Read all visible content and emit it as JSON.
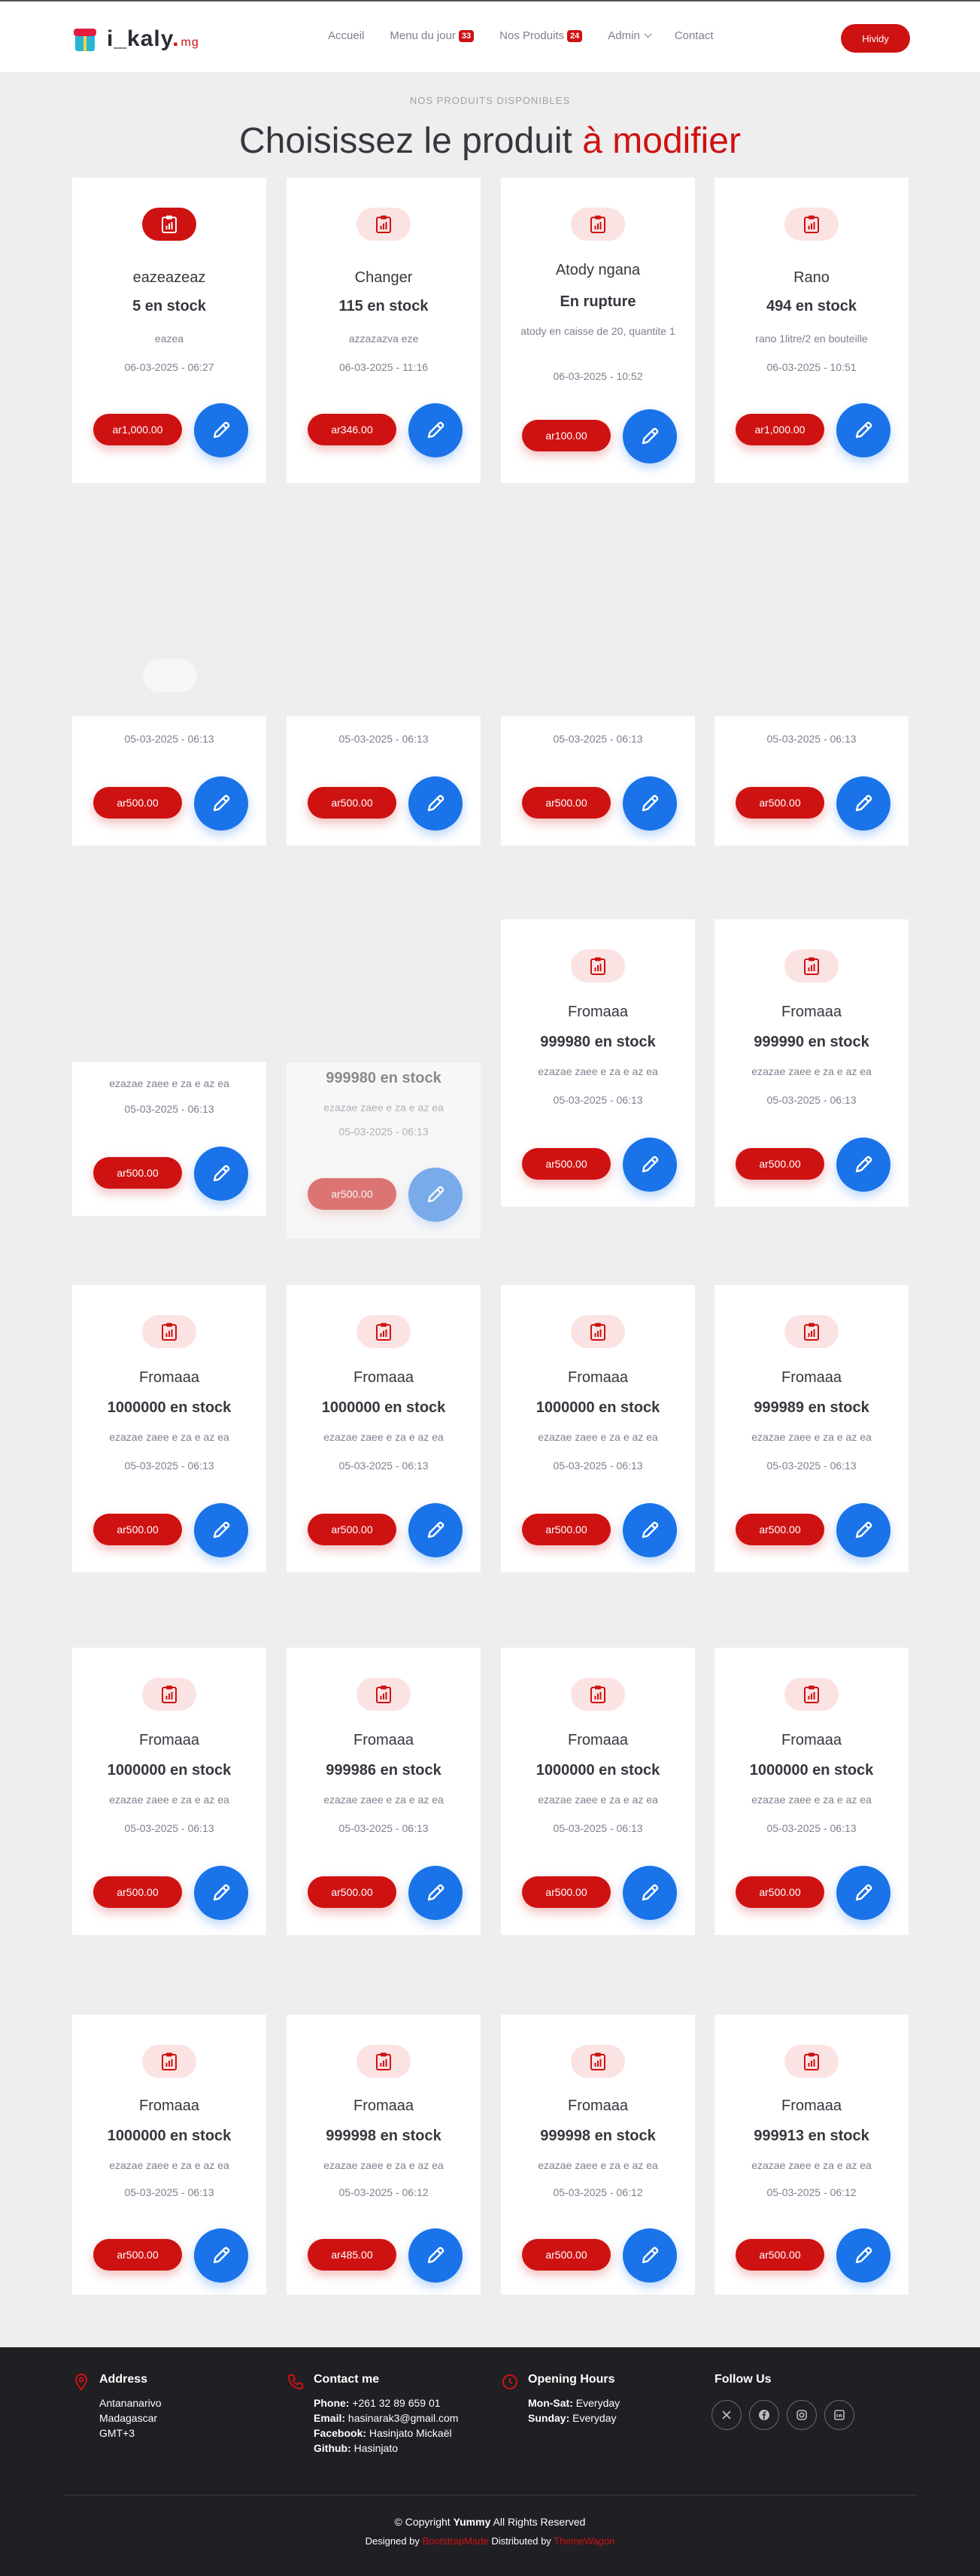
{
  "header": {
    "logo_text": "i_kaly",
    "logo_dot": ".",
    "logo_suffix": "mg",
    "nav": [
      {
        "label": "Accueil"
      },
      {
        "label": "Menu du jour",
        "badge": "33"
      },
      {
        "label": "Nos Produits",
        "badge": "24"
      },
      {
        "label": "Admin"
      },
      {
        "label": "Contact"
      }
    ],
    "cta_label": "Hividy"
  },
  "section": {
    "subtitle": "NOS PRODUITS DISPONIBLES",
    "title_main": "Choisissez le produit",
    "title_accent": "à modifier"
  },
  "products": [
    {
      "name": "eazeazeaz",
      "stock": "5 en stock",
      "desc": "eazea",
      "date": "06-03-2025 - 06:27",
      "price": "ar1,000.00",
      "active": true
    },
    {
      "name": "Changer",
      "stock": "115 en stock",
      "desc": "azzazazva eze",
      "date": "06-03-2025 - 11:16",
      "price": "ar346.00"
    },
    {
      "name": "Atody ngana",
      "stock": "En rupture",
      "desc": "atody en caisse de 20, quantite 1",
      "date": "06-03-2025 - 10:52",
      "price": "ar100.00"
    },
    {
      "name": "Rano",
      "stock": "494 en stock",
      "desc": "rano 1litre/2 en bouteille",
      "date": "06-03-2025 - 10:51",
      "price": "ar1,000.00"
    },
    {
      "date": "05-03-2025 - 06:13",
      "price": "ar500.00"
    },
    {
      "date": "05-03-2025 - 06:13",
      "price": "ar500.00"
    },
    {
      "date": "05-03-2025 - 06:13",
      "price": "ar500.00"
    },
    {
      "date": "05-03-2025 - 06:13",
      "price": "ar500.00"
    },
    {
      "desc": "ezazae zaee e za e az ea",
      "date": "05-03-2025 - 06:13",
      "price": "ar500.00"
    },
    {
      "stock": "999980 en stock",
      "desc": "ezazae zaee e za e az ea",
      "date": "05-03-2025 - 06:13",
      "price": "ar500.00"
    },
    {
      "name": "Fromaaa",
      "stock": "999980 en stock",
      "desc": "ezazae zaee e za e az ea",
      "date": "05-03-2025 - 06:13",
      "price": "ar500.00"
    },
    {
      "name": "Fromaaa",
      "stock": "999990 en stock",
      "desc": "ezazae zaee e za e az ea",
      "date": "05-03-2025 - 06:13",
      "price": "ar500.00"
    },
    {
      "name": "Fromaaa",
      "stock": "1000000 en stock",
      "desc": "ezazae zaee e za e az ea",
      "date": "05-03-2025 - 06:13",
      "price": "ar500.00"
    },
    {
      "name": "Fromaaa",
      "stock": "1000000 en stock",
      "desc": "ezazae zaee e za e az ea",
      "date": "05-03-2025 - 06:13",
      "price": "ar500.00"
    },
    {
      "name": "Fromaaa",
      "stock": "1000000 en stock",
      "desc": "ezazae zaee e za e az ea",
      "date": "05-03-2025 - 06:13",
      "price": "ar500.00"
    },
    {
      "name": "Fromaaa",
      "stock": "999989 en stock",
      "desc": "ezazae zaee e za e az ea",
      "date": "05-03-2025 - 06:13",
      "price": "ar500.00"
    },
    {
      "name": "Fromaaa",
      "stock": "1000000 en stock",
      "desc": "ezazae zaee e za e az ea",
      "date": "05-03-2025 - 06:13",
      "price": "ar500.00"
    },
    {
      "name": "Fromaaa",
      "stock": "999986 en stock",
      "desc": "ezazae zaee e za e az ea",
      "date": "05-03-2025 - 06:13",
      "price": "ar500.00"
    },
    {
      "name": "Fromaaa",
      "stock": "1000000 en stock",
      "desc": "ezazae zaee e za e az ea",
      "date": "05-03-2025 - 06:13",
      "price": "ar500.00"
    },
    {
      "name": "Fromaaa",
      "stock": "1000000 en stock",
      "desc": "ezazae zaee e za e az ea",
      "date": "05-03-2025 - 06:13",
      "price": "ar500.00"
    },
    {
      "name": "Fromaaa",
      "stock": "1000000 en stock",
      "desc": "ezazae zaee e za e az ea",
      "date": "05-03-2025 - 06:13",
      "price": "ar500.00"
    },
    {
      "name": "Fromaaa",
      "stock": "999998 en stock",
      "desc": "ezazae zaee e za e az ea",
      "date": "05-03-2025 - 06:12",
      "price": "ar485.00"
    },
    {
      "name": "Fromaaa",
      "stock": "999998 en stock",
      "desc": "ezazae zaee e za e az ea",
      "date": "05-03-2025 - 06:12",
      "price": "ar500.00"
    },
    {
      "name": "Fromaaa",
      "stock": "999913 en stock",
      "desc": "ezazae zaee e za e az ea",
      "date": "05-03-2025 - 06:12",
      "price": "ar500.00"
    }
  ],
  "footer": {
    "address": {
      "title": "Address",
      "lines": [
        "Antananarivo",
        "Madagascar",
        "GMT+3"
      ]
    },
    "contact": {
      "title": "Contact me",
      "phone_label": "Phone:",
      "phone": "+261 32 89 659 01",
      "email_label": "Email:",
      "email": "hasinarak3@gmail.com",
      "facebook_label": "Facebook:",
      "facebook": "Hasinjato Mickaël",
      "github_label": "Github:",
      "github": "Hasinjato"
    },
    "hours": {
      "title": "Opening Hours",
      "monsat_label": "Mon-Sat:",
      "monsat": "Everyday",
      "sunday_label": "Sunday:",
      "sunday": "Everyday"
    },
    "follow": {
      "title": "Follow Us",
      "icons": [
        "x-icon",
        "facebook-icon",
        "instagram-icon",
        "linkedin-icon"
      ]
    },
    "copyright_prefix": "© Copyright",
    "copyright_brand": "Yummy",
    "copyright_suffix": "All Rights Reserved",
    "designed_prefix": "Designed by",
    "designed_by": "BootstrapMade",
    "distributed_prefix": "Distributed by",
    "distributed_by": "ThemeWagon"
  },
  "colors": {
    "accent": "#ce1212",
    "edit_button": "#1a73e8",
    "footer_bg": "#1f1f24"
  }
}
